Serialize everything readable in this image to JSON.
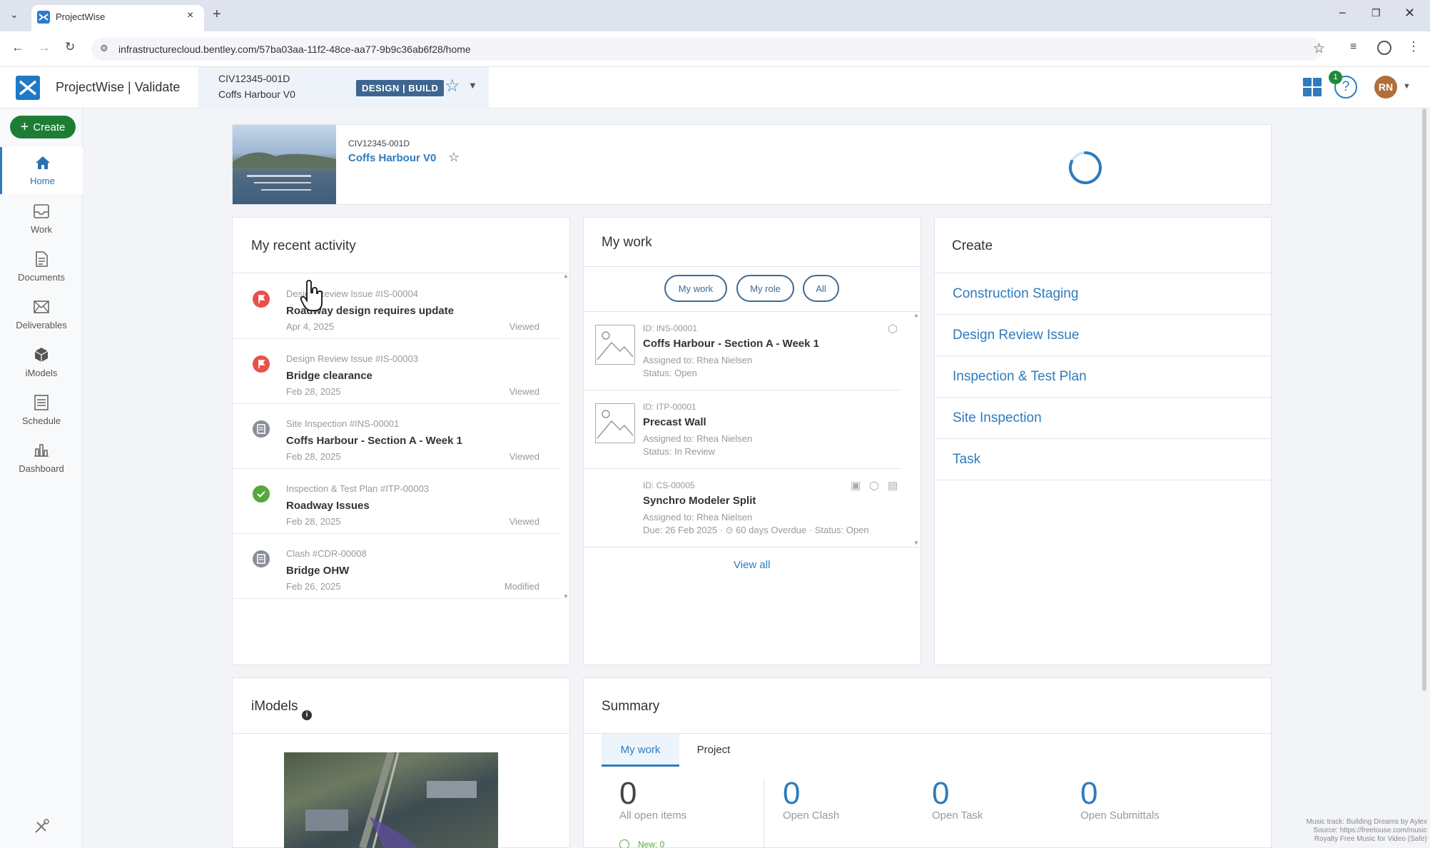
{
  "browser": {
    "tab_title": "ProjectWise",
    "url": "infrastructurecloud.bentley.com/57ba03aa-11f2-48ce-aa77-9b9c36ab6f28/home"
  },
  "app": {
    "name": "ProjectWise | Validate",
    "project_code": "CIV12345-001D",
    "project_name": "Coffs Harbour V0",
    "badge": "DESIGN | BUILD",
    "notifications": "1",
    "avatar_initials": "RN"
  },
  "sidebar": {
    "create_label": "Create",
    "items": [
      {
        "label": "Home"
      },
      {
        "label": "Work"
      },
      {
        "label": "Documents"
      },
      {
        "label": "Deliverables"
      },
      {
        "label": "iModels"
      },
      {
        "label": "Schedule"
      },
      {
        "label": "Dashboard"
      }
    ]
  },
  "header_card": {
    "code": "CIV12345-001D",
    "name": "Coffs Harbour V0"
  },
  "recent": {
    "title": "My recent activity",
    "items": [
      {
        "sub": "Design Review Issue #IS-00004",
        "title": "Roadway design requires update",
        "date": "Apr 4, 2025",
        "state": "Viewed",
        "color": "#e8514a"
      },
      {
        "sub": "Design Review Issue #IS-00003",
        "title": "Bridge clearance",
        "date": "Feb 28, 2025",
        "state": "Viewed",
        "color": "#e8514a"
      },
      {
        "sub": "Site Inspection #INS-00001",
        "title": "Coffs Harbour - Section A - Week 1",
        "date": "Feb 28, 2025",
        "state": "Viewed",
        "color": "#8a8f97"
      },
      {
        "sub": "Inspection & Test Plan #ITP-00003",
        "title": "Roadway Issues",
        "date": "Feb 28, 2025",
        "state": "Viewed",
        "color": "#56a83d"
      },
      {
        "sub": "Clash #CDR-00008",
        "title": "Bridge OHW",
        "date": "Feb 26, 2025",
        "state": "Modified",
        "color": "#8a8f97"
      }
    ]
  },
  "mywork": {
    "title": "My work",
    "filters": [
      "My work",
      "My role",
      "All"
    ],
    "items": [
      {
        "id": "ID: INS-00001",
        "title": "Coffs Harbour - Section A - Week 1",
        "assigned": "Assigned to: Rhea Nielsen",
        "status": "Status: Open"
      },
      {
        "id": "ID: ITP-00001",
        "title": "Precast Wall",
        "assigned": "Assigned to: Rhea Nielsen",
        "status": "Status: In Review"
      },
      {
        "id": "ID: CS-00005",
        "title": "Synchro Modeler Split",
        "assigned": "Assigned to: Rhea Nielsen",
        "status": "Due: 26 Feb 2025 · ⊙ 60 days Overdue · Status: Open"
      }
    ],
    "view_all": "View all"
  },
  "create_panel": {
    "title": "Create",
    "links": [
      "Construction Staging",
      "Design Review Issue",
      "Inspection & Test Plan",
      "Site Inspection",
      "Task"
    ]
  },
  "imodels": {
    "title": "iModels"
  },
  "summary": {
    "title": "Summary",
    "tabs": [
      "My work",
      "Project"
    ],
    "stats": [
      {
        "value": "0",
        "label": "All open items"
      },
      {
        "value": "0",
        "label": "Open Clash"
      },
      {
        "value": "0",
        "label": "Open Task"
      },
      {
        "value": "0",
        "label": "Open Submittals"
      }
    ],
    "new_label": "New: 0"
  },
  "watermark": {
    "line1": "Music track: Building Dreams by Aylex",
    "line2": "Source: https://freetouse.com/music",
    "line3": "Royalty Free Music for Video (Safe)"
  }
}
